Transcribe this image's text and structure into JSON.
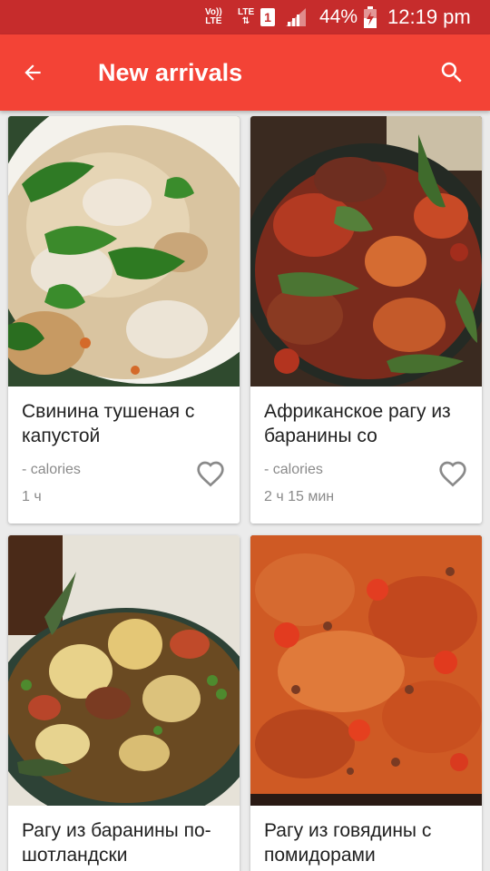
{
  "status_bar": {
    "volte_top": "Vo))",
    "volte_bottom": "LTE",
    "lte_top": "LTE",
    "lte_bottom": "⇅",
    "sim_slot": "1",
    "battery_percent": "44%",
    "time": "12:19 pm"
  },
  "app_bar": {
    "title": "New arrivals",
    "back_icon": "arrow-left-icon",
    "search_icon": "search-icon"
  },
  "recipes": [
    {
      "name": "Свинина тушеная с капустой",
      "calories": "- calories",
      "duration": "1 ч",
      "image": "stewed-pork-cabbage-photo",
      "favorite": false
    },
    {
      "name": "Африканское рагу из баранины со",
      "calories": "- calories",
      "duration": "2 ч 15 мин",
      "image": "african-lamb-stew-photo",
      "favorite": false
    },
    {
      "name": "Рагу из баранины по-шотландски",
      "calories": "",
      "duration": "",
      "image": "scottish-lamb-stew-photo",
      "favorite": false
    },
    {
      "name": "Рагу из говядины с помидорами",
      "calories": "",
      "duration": "",
      "image": "beef-tomato-stew-photo",
      "favorite": false
    }
  ],
  "colors": {
    "status_bar": "#c62c2c",
    "app_bar": "#f34336",
    "background": "#ebebeb"
  }
}
